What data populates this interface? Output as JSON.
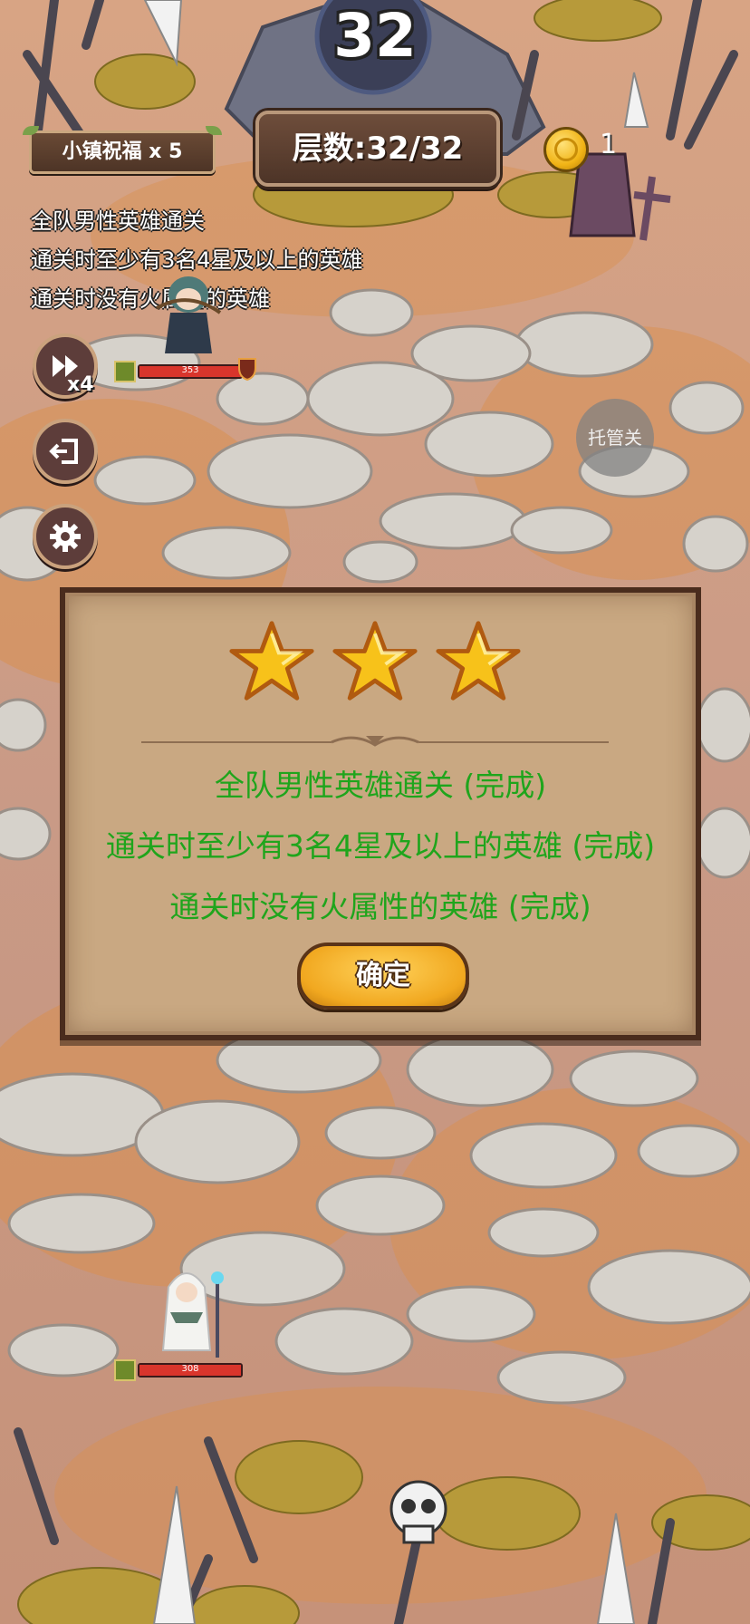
{
  "game": {
    "boss_counter": "32",
    "blessing": "小镇祝福 x 5",
    "floor": "层数:32/32",
    "coins": "1"
  },
  "objectives": [
    "全队男性英雄通关",
    "通关时至少有3名4星及以上的英雄",
    "通关时没有火属性的英雄"
  ],
  "controls": {
    "speed_label": "x4",
    "auto_label": "托管关"
  },
  "units": {
    "enemy": {
      "hp": "353",
      "hp_fraction": 1.0
    },
    "hero": {
      "hp": "308",
      "hp_fraction": 1.0
    }
  },
  "result": {
    "stars_earned": 3,
    "stars_total": 3,
    "lines": [
      "全队男性英雄通关 (完成)",
      "通关时至少有3名4星及以上的英雄 (完成)",
      "通关时没有火属性的英雄 (完成)"
    ],
    "confirm_label": "确定"
  },
  "colors": {
    "success_text": "#1fa51c",
    "star": "#f7c21a",
    "dialog_bg": "#c9a882",
    "ground_pink": "#c99a80",
    "ground_orange": "#d99050"
  },
  "icons": [
    "fast-forward-icon",
    "exit-icon",
    "gear-icon",
    "coin-icon",
    "star-icon",
    "skull-icon",
    "class-icon"
  ]
}
